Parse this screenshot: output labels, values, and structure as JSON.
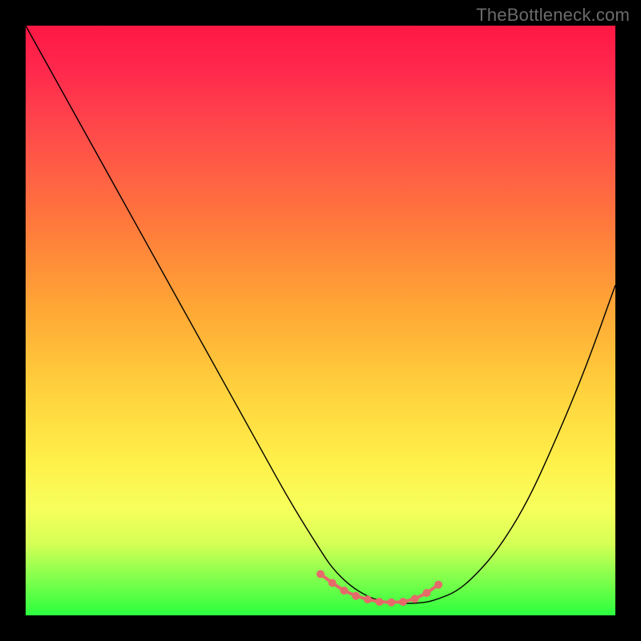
{
  "watermark": "TheBottleneck.com",
  "chart_data": {
    "type": "line",
    "title": "",
    "xlabel": "",
    "ylabel": "",
    "xlim": [
      0,
      100
    ],
    "ylim": [
      0,
      100
    ],
    "grid": false,
    "legend": false,
    "background_gradient": {
      "direction": "vertical",
      "stops": [
        {
          "pos": 0.0,
          "color": "#ff1744"
        },
        {
          "pos": 0.5,
          "color": "#ffb73d"
        },
        {
          "pos": 0.8,
          "color": "#f7ff5c"
        },
        {
          "pos": 1.0,
          "color": "#2bff3e"
        }
      ]
    },
    "series": [
      {
        "name": "bottleneck-curve",
        "color": "#000000",
        "x": [
          0,
          5,
          10,
          15,
          20,
          25,
          30,
          35,
          40,
          45,
          50,
          52,
          55,
          58,
          60,
          63,
          65,
          68,
          70,
          73,
          76,
          80,
          85,
          90,
          95,
          100
        ],
        "y": [
          100,
          91,
          82,
          73,
          64,
          55,
          46,
          37,
          28,
          19,
          11,
          8,
          5,
          3.2,
          2.5,
          2.1,
          2,
          2.2,
          2.8,
          4,
          6.5,
          11,
          19,
          30,
          42,
          56
        ]
      }
    ],
    "markers": {
      "name": "highlight-dots",
      "color": "#e56a6a",
      "x": [
        50,
        52,
        54,
        56,
        58,
        60,
        62,
        64,
        66,
        68,
        70
      ],
      "y": [
        7,
        5.5,
        4.2,
        3.3,
        2.7,
        2.3,
        2.2,
        2.3,
        2.8,
        3.8,
        5.2
      ]
    }
  }
}
